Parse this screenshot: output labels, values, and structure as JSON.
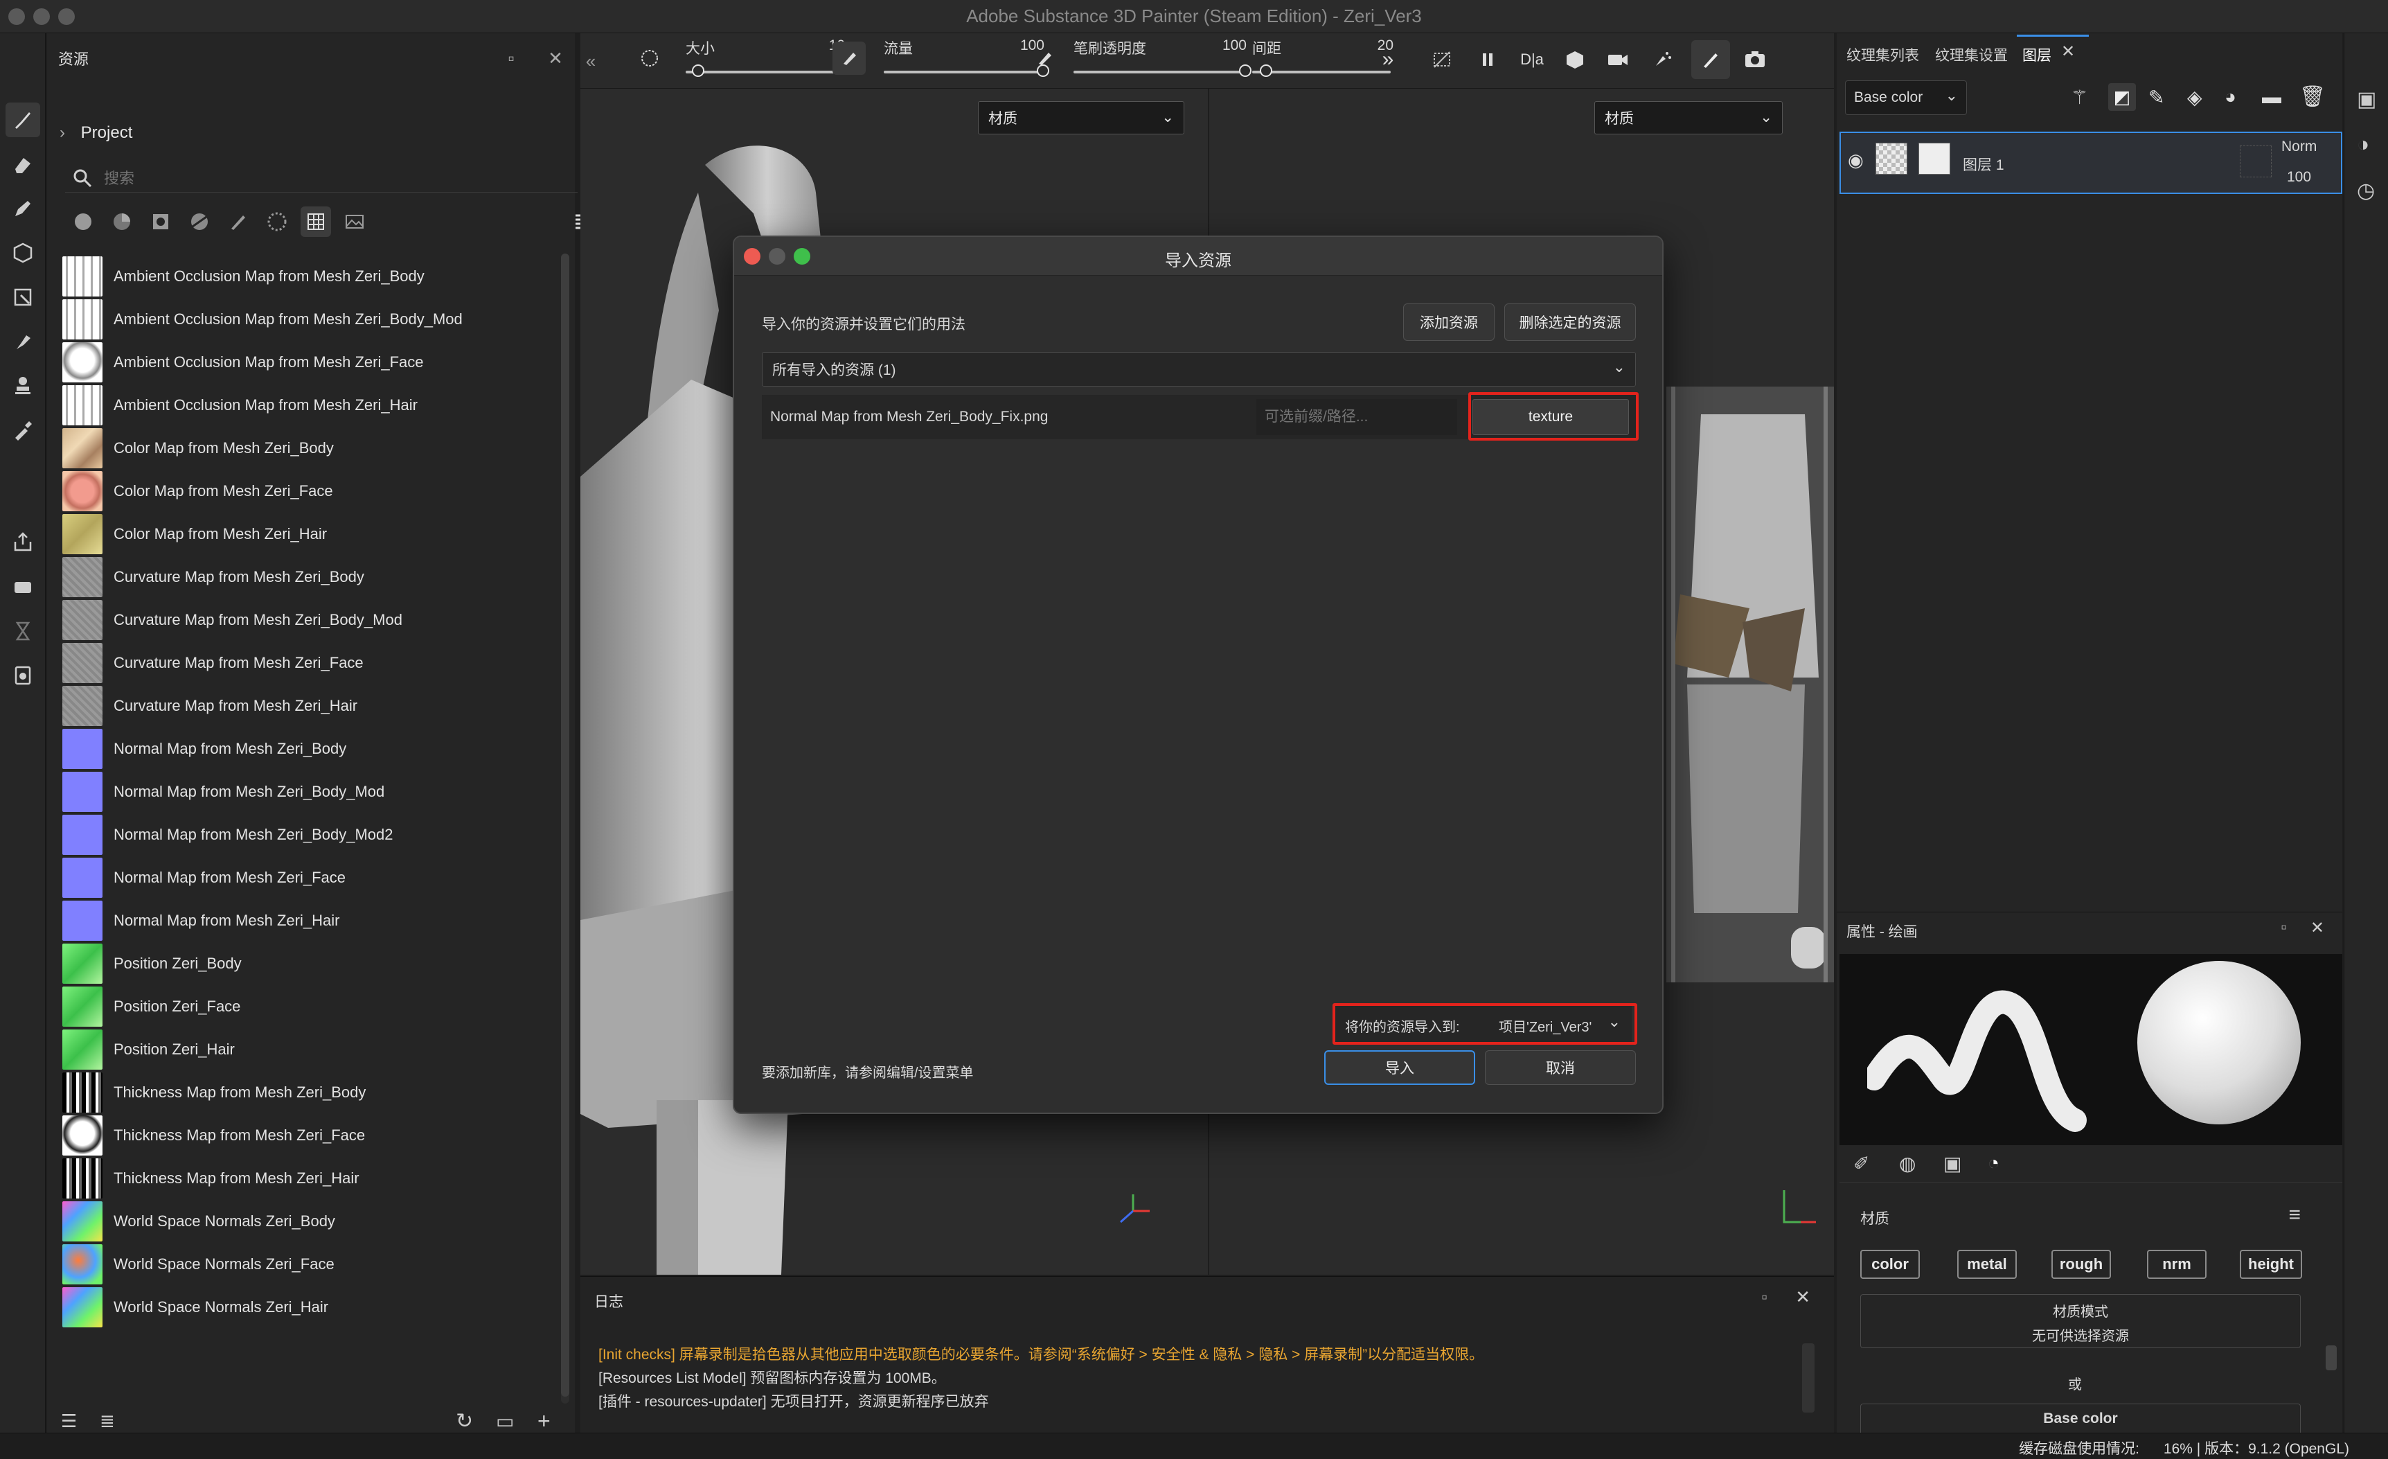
{
  "app": {
    "title": "Adobe Substance 3D Painter (Steam Edition) - Zeri_Ver3"
  },
  "assets_panel": {
    "title": "资源",
    "project_label": "Project",
    "search_placeholder": "搜索",
    "items": [
      {
        "label": "Ambient Occlusion Map from Mesh Zeri_Body",
        "thumb": "ao"
      },
      {
        "label": "Ambient Occlusion Map from Mesh Zeri_Body_Mod",
        "thumb": "ao"
      },
      {
        "label": "Ambient Occlusion Map from Mesh Zeri_Face",
        "thumb": "ao-face"
      },
      {
        "label": "Ambient Occlusion Map from Mesh Zeri_Hair",
        "thumb": "ao"
      },
      {
        "label": "Color Map from Mesh Zeri_Body",
        "thumb": "color"
      },
      {
        "label": "Color Map from Mesh Zeri_Face",
        "thumb": "color-face"
      },
      {
        "label": "Color Map from Mesh Zeri_Hair",
        "thumb": "color-hair"
      },
      {
        "label": "Curvature Map from Mesh Zeri_Body",
        "thumb": "curv"
      },
      {
        "label": "Curvature Map from Mesh Zeri_Body_Mod",
        "thumb": "curv"
      },
      {
        "label": "Curvature Map from Mesh Zeri_Face",
        "thumb": "curv"
      },
      {
        "label": "Curvature Map from Mesh Zeri_Hair",
        "thumb": "curv"
      },
      {
        "label": "Normal Map from Mesh Zeri_Body",
        "thumb": "normal"
      },
      {
        "label": "Normal Map from Mesh Zeri_Body_Mod",
        "thumb": "normal"
      },
      {
        "label": "Normal Map from Mesh Zeri_Body_Mod2",
        "thumb": "normal"
      },
      {
        "label": "Normal Map from Mesh Zeri_Face",
        "thumb": "normal"
      },
      {
        "label": "Normal Map from Mesh Zeri_Hair",
        "thumb": "normal"
      },
      {
        "label": "Position Zeri_Body",
        "thumb": "pos"
      },
      {
        "label": "Position Zeri_Face",
        "thumb": "pos"
      },
      {
        "label": "Position Zeri_Hair",
        "thumb": "pos"
      },
      {
        "label": "Thickness Map from Mesh Zeri_Body",
        "thumb": "thick"
      },
      {
        "label": "Thickness Map from Mesh Zeri_Face",
        "thumb": "thick-face"
      },
      {
        "label": "Thickness Map from Mesh Zeri_Hair",
        "thumb": "thick"
      },
      {
        "label": "World Space Normals Zeri_Body",
        "thumb": "wsn"
      },
      {
        "label": "World Space Normals Zeri_Face",
        "thumb": "wsn-face"
      },
      {
        "label": "World Space Normals Zeri_Hair",
        "thumb": "wsn"
      }
    ]
  },
  "toolbar": {
    "size_label": "大小",
    "size_value": "10",
    "size_level": 0.08,
    "flow_label": "流量",
    "flow_value": "100",
    "flow_level": 1.0,
    "opacity_label": "笔刷透明度",
    "opacity_value": "100",
    "opacity_level": 1.0,
    "spacing_label": "间距",
    "spacing_value": "20",
    "spacing_level": 0.1
  },
  "viewport": {
    "left_channel": "材质",
    "right_channel": "材质"
  },
  "dialog": {
    "title": "导入资源",
    "subtitle": "导入你的资源并设置它们的用法",
    "add_button": "添加资源",
    "remove_button": "删除选定的资源",
    "filter_label": "所有导入的资源 (1)",
    "file_name": "Normal Map from Mesh Zeri_Body_Fix.png",
    "prefix_placeholder": "可选前缀/路径...",
    "usage_value": "texture",
    "destination_label": "将你的资源导入到:",
    "destination_value": "项目'Zeri_Ver3'",
    "footer_hint": "要添加新库，请参阅编辑/设置菜单",
    "import_button": "导入",
    "cancel_button": "取消"
  },
  "log": {
    "title": "日志",
    "lines": [
      {
        "text": "[Init checks] 屏幕录制是拾色器从其他应用中选取颜色的必要条件。请参阅“系统偏好 > 安全性 & 隐私 > 隐私 > 屏幕录制”以分配适当权限。",
        "color": "#e8a531"
      },
      {
        "text": "[Resources List Model] 预留图标内存设置为 100MB。",
        "color": "#d8d8d8"
      },
      {
        "text": "[插件 - resources-updater] 无项目打开，资源更新程序已放弃",
        "color": "#d8d8d8"
      }
    ]
  },
  "right_panel": {
    "tabs": [
      "纹理集列表",
      "纹理集设置",
      "图层"
    ],
    "channel_select": "Base color",
    "layer_name": "图层 1",
    "blend_mode": "Norm",
    "layer_opacity": "100",
    "props_title": "属性 - 绘画",
    "material_label": "材质",
    "channels": [
      "color",
      "metal",
      "rough",
      "nrm",
      "height"
    ],
    "material_mode_label": "材质模式",
    "material_mode_value": "无可供选择资源",
    "or_label": "或",
    "base_color_label": "Base color"
  },
  "status": {
    "text": "缓存磁盘使用情况:      16% | 版本：9.1.2 (OpenGL)"
  },
  "colors": {
    "accent": "#3a8ee6",
    "highlight_box": "#e3231c",
    "warning": "#e8a531"
  }
}
